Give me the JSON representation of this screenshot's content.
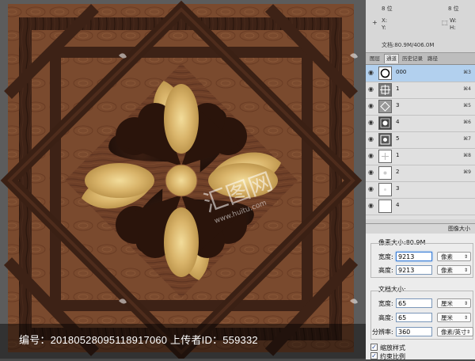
{
  "caption": {
    "text": "编号：20180528095118917060 上传者ID：559332"
  },
  "watermark": {
    "brand_text": "汇图网",
    "url_text": "www.huitu.com"
  },
  "info_panel": {
    "bit_depth_left": "8 位",
    "bit_depth_right": "8 位",
    "x_label": "X:",
    "y_label": "Y:",
    "w_label": "W:",
    "h_label": "H:",
    "doc_size": "文档:80.9M/406.0M"
  },
  "tabs": [
    {
      "label": "图层",
      "active": false
    },
    {
      "label": "通道",
      "active": true
    },
    {
      "label": "历史记录",
      "active": false
    },
    {
      "label": "路径",
      "active": false
    }
  ],
  "channels": [
    {
      "name": "000",
      "shortcut": "⌘3",
      "selected": true
    },
    {
      "name": "1",
      "shortcut": "⌘4",
      "selected": false
    },
    {
      "name": "3",
      "shortcut": "⌘5",
      "selected": false
    },
    {
      "name": "4",
      "shortcut": "⌘6",
      "selected": false
    },
    {
      "name": "5",
      "shortcut": "⌘7",
      "selected": false
    },
    {
      "name": "1",
      "shortcut": "⌘8",
      "selected": false
    },
    {
      "name": "2",
      "shortcut": "⌘9",
      "selected": false
    },
    {
      "name": "3",
      "shortcut": "",
      "selected": false
    },
    {
      "name": "4",
      "shortcut": "",
      "selected": false
    }
  ],
  "dialog": {
    "title": "图像大小",
    "pixel_size_label": "像素大小:80.9M",
    "width_label": "宽度:",
    "width_value": "9213",
    "width_unit": "像素",
    "height_label": "高度:",
    "height_value": "9213",
    "height_unit": "像素",
    "doc_size_label": "文档大小:",
    "doc_width_label": "宽度:",
    "doc_width_value": "65",
    "doc_width_unit": "厘米",
    "doc_height_label": "高度:",
    "doc_height_value": "65",
    "doc_height_unit": "厘米",
    "resolution_label": "分辨率:",
    "resolution_value": "360",
    "resolution_unit": "像素/英寸",
    "scale_styles_label": "缩放样式",
    "constrain_label": "约束比例"
  },
  "colors": {
    "wood_dark": "#3a2014",
    "wood_mid": "#6b3e26",
    "wood_light": "#8a5636",
    "onyx": "#d9b46a",
    "selection_blue": "#b2d0ee"
  }
}
